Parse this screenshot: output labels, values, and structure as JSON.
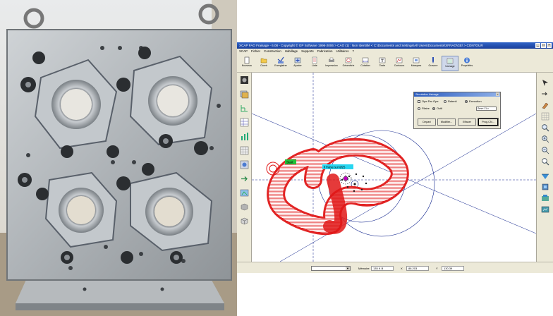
{
  "app": {
    "title": "XCAP FAO Fraisage - 6.08 - Copyright © GP Software 1996-2006 > CAO (1) : Non Identifié < C:\\Documents and Settings\\All Users\\Documents\\XFRAO\\GE\\ > CONTOUR",
    "window_buttons": [
      "_",
      "□",
      "×"
    ]
  },
  "menu": [
    "XCAP",
    "Fichier",
    "Construction",
    "Habillage",
    "Supports",
    "Fabrication",
    "Utilitaires",
    "?"
  ],
  "toolbar": [
    {
      "label": "Nouveau",
      "icon": "new-file-icon"
    },
    {
      "label": "Ouvrir",
      "icon": "open-folder-icon"
    },
    {
      "label": "Enregistrer",
      "icon": "save-icon"
    },
    {
      "label": "Ajouter",
      "icon": "add-icon"
    },
    {
      "label": "Liste",
      "icon": "list-icon"
    },
    {
      "label": "Impression",
      "icon": "print-icon"
    },
    {
      "label": "Géométrie",
      "icon": "geometry-icon"
    },
    {
      "label": "Cotation",
      "icon": "dimension-icon"
    },
    {
      "label": "Texte",
      "icon": "text-icon"
    },
    {
      "label": "Contours",
      "icon": "contours-icon"
    },
    {
      "label": "Masques",
      "icon": "masks-icon"
    },
    {
      "label": "Gravure",
      "icon": "engraving-icon"
    },
    {
      "label": "Usinage",
      "icon": "machining-icon"
    },
    {
      "label": "Propriétés",
      "icon": "properties-icon"
    }
  ],
  "left_tools": [
    "part-icon",
    "layers-icon",
    "tree-icon",
    "table-icon",
    "bars-icon",
    "grid-icon",
    "shape-icon",
    "import-icon",
    "export-icon",
    "box-icon",
    "box2-icon"
  ],
  "right_tools": [
    "cursor-icon",
    "pointer-icon",
    "hand-icon",
    "grid-icon",
    "zoom-icon",
    "zoom-in-icon",
    "zoom-out-icon",
    "zoom-fit-icon",
    "view-icon",
    "view-3d-icon",
    "refresh-icon",
    "render-icon"
  ],
  "dialog": {
    "title": "Simulation Usinage",
    "checkbox_label": "Ope Par Ope",
    "radio_ralenti": "Ralenti",
    "radio_execution": "Execution",
    "radio_filaire": "Filaire",
    "radio_outil": "Outil",
    "input_value": "Smm 11 c",
    "buttons": {
      "depart": "Depart",
      "modifier": "Modifier...",
      "effacer": "Effacer",
      "prog": "Prog.CN..."
    }
  },
  "canvas": {
    "label_start": "Start",
    "label_tool": "Il fraise sur Ø25",
    "colors": {
      "toolpath": "#e01818",
      "construction": "#0b1f8a",
      "start_label": "#22c33a",
      "tool_label": "#28d6f0"
    }
  },
  "status": {
    "memory_label": "Mémoire",
    "memory_value": "135 K.B",
    "x_label": "X",
    "x_value": "88.203",
    "y_label": "Y",
    "y_value": "130.39"
  }
}
